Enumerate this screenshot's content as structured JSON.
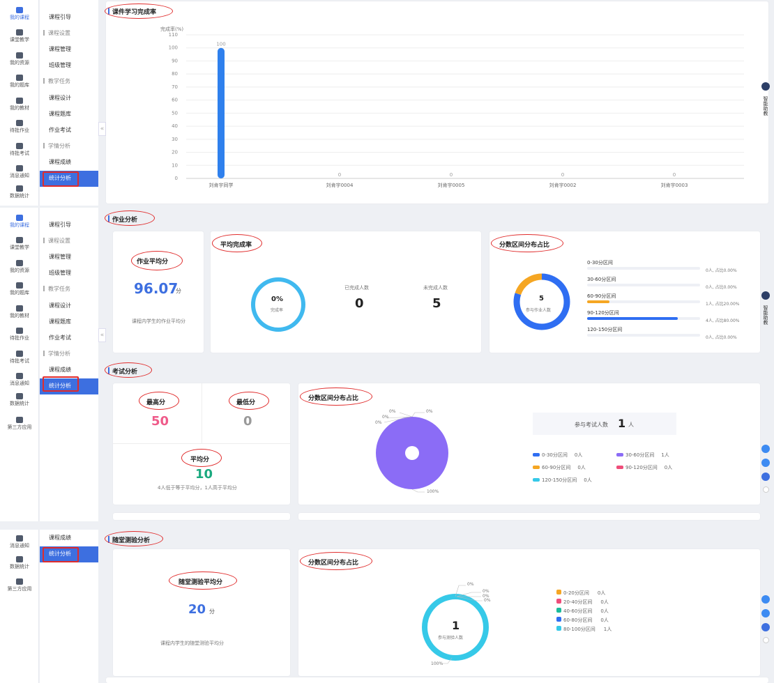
{
  "rail": {
    "items": [
      "我的课程",
      "课堂教学",
      "我的资源",
      "我的题库",
      "我的教材",
      "待批作业",
      "待批考试",
      "消息通知",
      "数据统计",
      "第三方应用"
    ]
  },
  "subnav": {
    "items": [
      "课程引导",
      "课程设置",
      "课程管理",
      "班级管理",
      "教学任务",
      "课程设计",
      "课程题库",
      "作业考试",
      "学情分析",
      "课程成绩",
      "统计分析"
    ]
  },
  "assistant": {
    "label": "智能助教"
  },
  "courseware": {
    "title": "课件学习完成率",
    "chart_data": {
      "type": "bar",
      "ylabel": "完成率(%)",
      "ylim": [
        0,
        110
      ],
      "yticks": [
        0,
        10,
        20,
        30,
        40,
        50,
        60,
        70,
        80,
        90,
        100,
        110
      ],
      "categories": [
        "刘肯宇同学",
        "刘肯宇0004",
        "刘肯宇0005",
        "刘肯宇0002",
        "刘肯宇0003"
      ],
      "values": [
        100,
        0,
        0,
        0,
        0
      ],
      "data_labels": [
        "100",
        "0",
        "0",
        "0",
        "0"
      ],
      "color": "#2f80ed"
    }
  },
  "homework": {
    "title": "作业分析",
    "avg": {
      "label": "作业平均分",
      "value": "96.07",
      "unit": "分",
      "desc": "课程内学生的作业平均分"
    },
    "completion": {
      "label": "平均完成率",
      "pct": "0%",
      "pct_label": "完成率",
      "done_label": "已完成人数",
      "done": "0",
      "undone_label": "未完成人数",
      "undone": "5"
    },
    "dist": {
      "label": "分数区间分布占比",
      "total": "5",
      "total_label": "参与作业人数",
      "rows": [
        {
          "name": "0-30分区间",
          "stat": "0人, 占比0.00%",
          "fraction": 0
        },
        {
          "name": "30-60分区间",
          "stat": "0人, 占比0.00%",
          "fraction": 0
        },
        {
          "name": "60-90分区间",
          "stat": "1人, 占比20.00%",
          "fraction": 0.2
        },
        {
          "name": "90-120分区间",
          "stat": "4人, 占比80.00%",
          "fraction": 0.8
        },
        {
          "name": "120-150分区间",
          "stat": "0人, 占比0.00%",
          "fraction": 0
        }
      ],
      "donut_fractions": [
        0.8,
        0.2
      ],
      "donut_colors": [
        "#2f6ef2",
        "#f5a623"
      ]
    }
  },
  "exam": {
    "title": "考试分析",
    "max": {
      "label": "最高分",
      "value": "50"
    },
    "min": {
      "label": "最低分",
      "value": "0"
    },
    "avg": {
      "label": "平均分",
      "value": "10",
      "desc": "4人低于等于平均分，1人高于平均分"
    },
    "dist": {
      "label": "分数区间分布占比",
      "participants_label": "参与考试人数",
      "participants": "1",
      "unit": "人",
      "pie_labels": [
        "0%",
        "0%",
        "0%",
        "0%",
        "100%"
      ],
      "legend": [
        {
          "name": "0-30分区间",
          "count": "0人",
          "color": "#2f6ef2"
        },
        {
          "name": "30-60分区间",
          "count": "1人",
          "color": "#8b6cf6"
        },
        {
          "name": "60-90分区间",
          "count": "0人",
          "color": "#f5a623"
        },
        {
          "name": "90-120分区间",
          "count": "0人",
          "color": "#ef4d7a"
        },
        {
          "name": "120-150分区间",
          "count": "0人",
          "color": "#36c9e8"
        }
      ]
    }
  },
  "quiz": {
    "title": "随堂测验分析",
    "avg": {
      "label": "随堂测验平均分",
      "value": "20",
      "unit": "分",
      "desc": "课程内学生的随堂测验平均分"
    },
    "dist": {
      "label": "分数区间分布占比",
      "total": "1",
      "total_label": "参与测验人数",
      "pie_labels": [
        "0%",
        "0%",
        "0%",
        "0%",
        "100%"
      ],
      "legend": [
        {
          "name": "0-20分区间",
          "count": "0人",
          "color": "#f5a623"
        },
        {
          "name": "20-40分区间",
          "count": "0人",
          "color": "#ef4d7a"
        },
        {
          "name": "40-60分区间",
          "count": "0人",
          "color": "#1abc9c"
        },
        {
          "name": "60-80分区间",
          "count": "0人",
          "color": "#2f6ef2"
        },
        {
          "name": "80-100分区间",
          "count": "1人",
          "color": "#36c9e8"
        }
      ]
    }
  }
}
